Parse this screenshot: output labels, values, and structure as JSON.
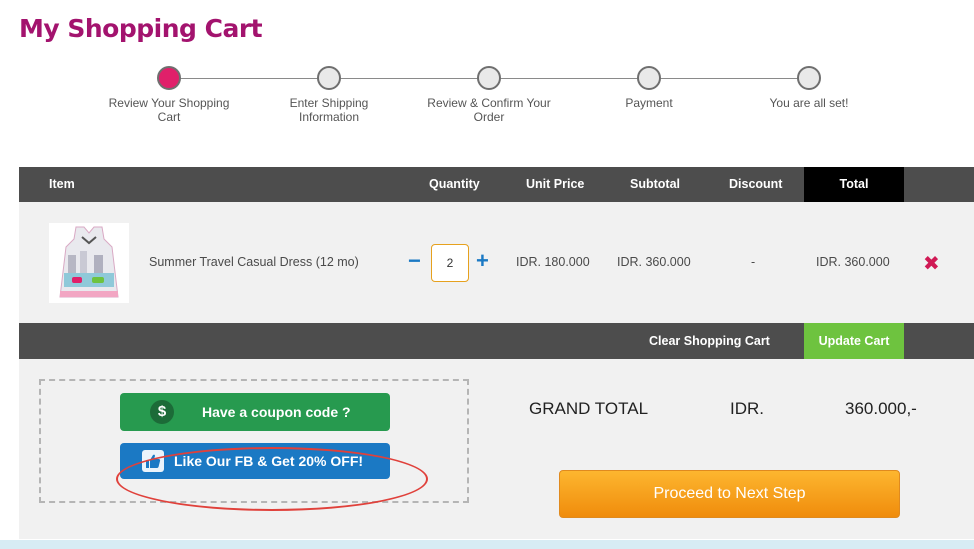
{
  "page": {
    "title": "My Shopping Cart"
  },
  "steps": [
    {
      "label": "Review Your Shopping Cart",
      "active": true
    },
    {
      "label": "Enter Shipping Information",
      "active": false
    },
    {
      "label": "Review & Confirm Your Order",
      "active": false
    },
    {
      "label": "Payment",
      "active": false
    },
    {
      "label": "You are all set!",
      "active": false
    }
  ],
  "table": {
    "headers": {
      "item": "Item",
      "quantity": "Quantity",
      "unit_price": "Unit Price",
      "subtotal": "Subtotal",
      "discount": "Discount",
      "total": "Total"
    },
    "rows": [
      {
        "name": "Summer Travel Casual Dress (12 mo)",
        "quantity": "2",
        "unit_price": "IDR. 180.000",
        "subtotal": "IDR. 360.000",
        "discount": "-",
        "total": "IDR. 360.000",
        "remove_icon": "close-icon"
      }
    ]
  },
  "actions": {
    "clear_cart": "Clear Shopping Cart",
    "update_cart": "Update Cart"
  },
  "coupon": {
    "button_label": "Have a coupon code ?",
    "icon": "dollar-icon",
    "icon_glyph": "$"
  },
  "facebook": {
    "button_label": "Like Our FB & Get 20% OFF!",
    "icon": "thumbs-up-icon"
  },
  "totals": {
    "label": "GRAND TOTAL",
    "currency": "IDR.",
    "value": "360.000,-"
  },
  "proceed": {
    "label": "Proceed to Next Step"
  },
  "colors": {
    "brand": "#a3136e",
    "active_step": "#e0206a",
    "update_green": "#6ec33f",
    "coupon_green": "#279a4f",
    "fb_blue": "#1b79c4",
    "proceed_orange": "#f5a01f",
    "remove_red": "#d01a55"
  }
}
